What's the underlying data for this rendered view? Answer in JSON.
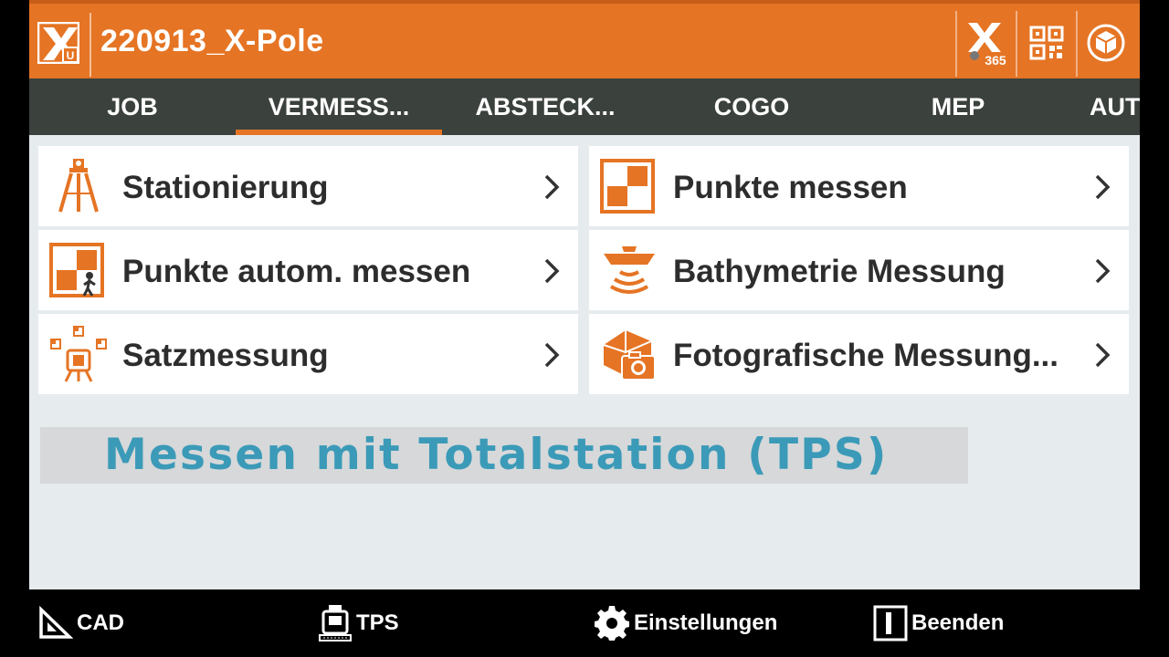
{
  "header": {
    "title": "220913_X-Pole",
    "logo_letter": "U",
    "x365_label": "365",
    "colors": {
      "header_bg": "#e57424",
      "tab_bg": "#3b413d",
      "accent": "#e57424"
    }
  },
  "tabs": [
    {
      "label": "JOB",
      "active": false
    },
    {
      "label": "VERMESS...",
      "active": true
    },
    {
      "label": "ABSTECK...",
      "active": false
    },
    {
      "label": "COGO",
      "active": false
    },
    {
      "label": "MEP",
      "active": false
    },
    {
      "label": "AUT",
      "active": false
    }
  ],
  "menu": {
    "left": [
      {
        "label": "Stationierung",
        "icon": "tripod-icon"
      },
      {
        "label": "Punkte autom. messen",
        "icon": "auto-measure-icon"
      },
      {
        "label": "Satzmessung",
        "icon": "set-measurement-icon"
      }
    ],
    "right": [
      {
        "label": "Punkte messen",
        "icon": "measure-points-icon"
      },
      {
        "label": "Bathymetrie Messung",
        "icon": "boat-sonar-icon"
      },
      {
        "label": "Fotografische Messung...",
        "icon": "photo-measure-icon"
      }
    ]
  },
  "caption": "Messen mit Totalstation (TPS)",
  "bottom": {
    "cad": "CAD",
    "tps": "TPS",
    "settings": "Einstellungen",
    "exit": "Beenden"
  }
}
